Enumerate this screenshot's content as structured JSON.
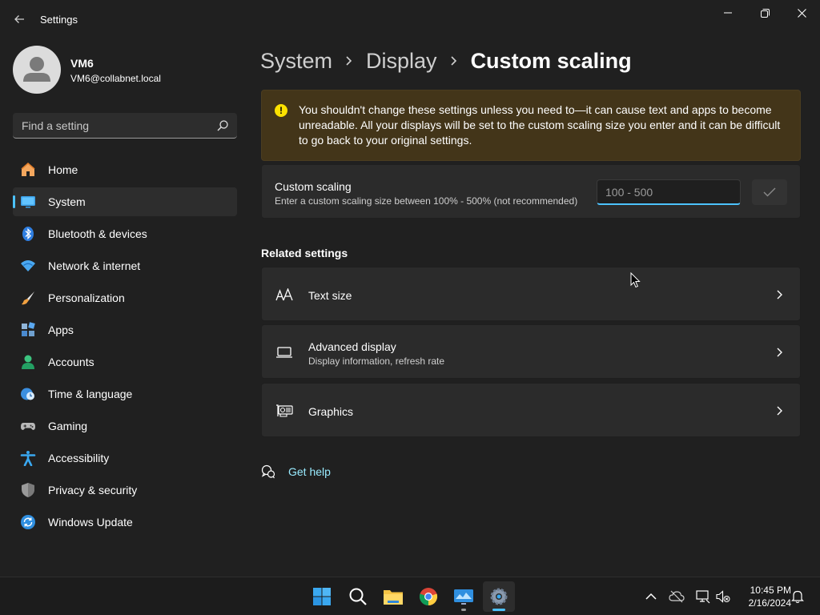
{
  "window": {
    "title": "Settings"
  },
  "user": {
    "name": "VM6",
    "email": "VM6@collabnet.local"
  },
  "search": {
    "placeholder": "Find a setting"
  },
  "nav": {
    "items": [
      {
        "label": "Home",
        "icon": "home-icon"
      },
      {
        "label": "System",
        "icon": "system-icon"
      },
      {
        "label": "Bluetooth & devices",
        "icon": "bluetooth-icon"
      },
      {
        "label": "Network & internet",
        "icon": "wifi-icon"
      },
      {
        "label": "Personalization",
        "icon": "brush-icon"
      },
      {
        "label": "Apps",
        "icon": "apps-icon"
      },
      {
        "label": "Accounts",
        "icon": "accounts-icon"
      },
      {
        "label": "Time & language",
        "icon": "time-language-icon"
      },
      {
        "label": "Gaming",
        "icon": "gamepad-icon"
      },
      {
        "label": "Accessibility",
        "icon": "accessibility-icon"
      },
      {
        "label": "Privacy & security",
        "icon": "shield-icon"
      },
      {
        "label": "Windows Update",
        "icon": "update-icon"
      }
    ],
    "active_index": 1
  },
  "breadcrumb": {
    "items": [
      "System",
      "Display"
    ],
    "current": "Custom scaling"
  },
  "warning": {
    "text": "You shouldn't change these settings unless you need to—it can cause text and apps to become unreadable. All your displays will be set to the custom scaling size you enter and it can be difficult to go back to your original settings."
  },
  "custom_scaling": {
    "title": "Custom scaling",
    "description": "Enter a custom scaling size between 100% - 500% (not recommended)",
    "input_value": "",
    "input_placeholder": "100 - 500"
  },
  "related": {
    "heading": "Related settings",
    "items": [
      {
        "title": "Text size",
        "subtitle": "",
        "icon": "text-size-icon"
      },
      {
        "title": "Advanced display",
        "subtitle": "Display information, refresh rate",
        "icon": "monitor-icon"
      },
      {
        "title": "Graphics",
        "subtitle": "",
        "icon": "graphics-card-icon"
      }
    ]
  },
  "help": {
    "label": "Get help"
  },
  "taskbar": {
    "apps": [
      "start-icon",
      "search-icon",
      "file-explorer-icon",
      "chrome-icon",
      "remote-desktop-icon",
      "settings-icon"
    ],
    "time": "10:45 PM",
    "date": "2/16/2024"
  },
  "colors": {
    "accent": "#4cc2ff",
    "warning_bg": "#433519",
    "warning_icon": "#fce100",
    "link": "#99ebff",
    "background": "#202020",
    "card": "#2b2b2b"
  }
}
